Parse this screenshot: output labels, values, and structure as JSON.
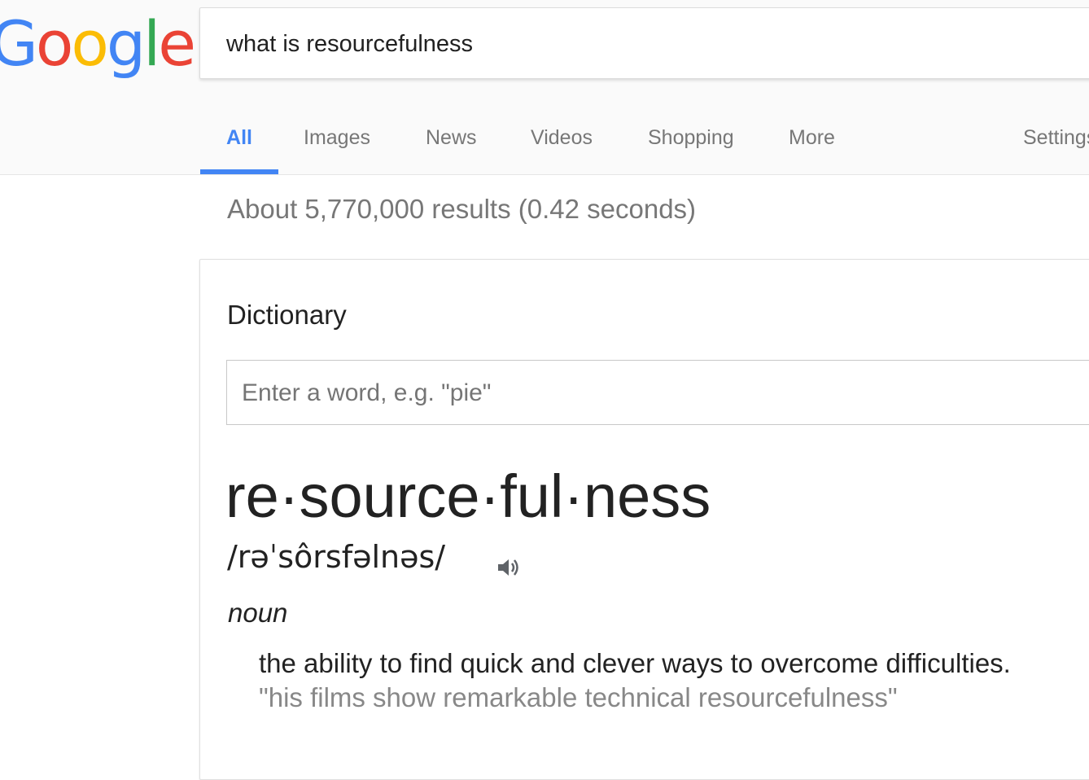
{
  "logo": {
    "letters": [
      "G",
      "o",
      "o",
      "g",
      "l",
      "e"
    ],
    "colors": [
      "#4285f4",
      "#ea4335",
      "#fbbc05",
      "#4285f4",
      "#34a853",
      "#ea4335"
    ]
  },
  "search": {
    "query": "what is resourcefulness"
  },
  "tabs": [
    {
      "label": "All",
      "active": true
    },
    {
      "label": "Images",
      "active": false
    },
    {
      "label": "News",
      "active": false
    },
    {
      "label": "Videos",
      "active": false
    },
    {
      "label": "Shopping",
      "active": false
    },
    {
      "label": "More",
      "active": false
    }
  ],
  "settings_label": "Settings",
  "results_stats": "About 5,770,000 results (0.42 seconds)",
  "dictionary": {
    "title": "Dictionary",
    "placeholder": "Enter a word, e.g. \"pie\"",
    "headword": "re·source·ful·ness",
    "phonetic": "/rəˈsôrsfəlnəs/",
    "speaker_icon": "speaker-icon",
    "part_of_speech": "noun",
    "definition": "the ability to find quick and clever ways to overcome difficulties.",
    "example": "\"his films show remarkable technical resourcefulness\""
  },
  "colors": {
    "accent": "#4285f4",
    "tab_text": "#777777",
    "text": "#222222",
    "muted": "#888888"
  }
}
